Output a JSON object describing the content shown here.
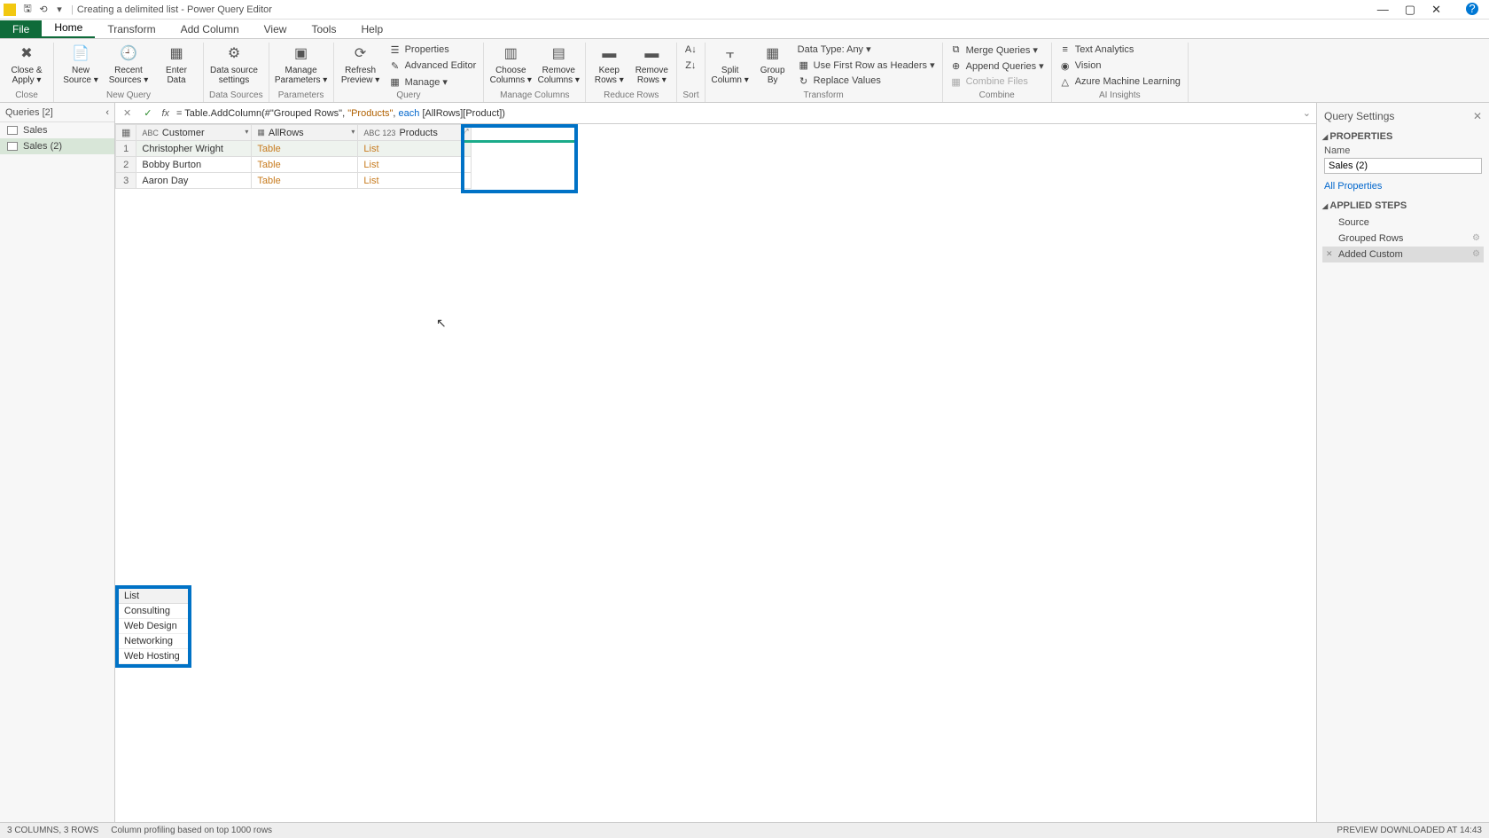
{
  "title": {
    "doc": "Creating a delimited list",
    "app": "Power Query Editor"
  },
  "qat": {
    "save": "🖫",
    "undo": "⟲",
    "redo": "⟳"
  },
  "menu": {
    "file": "File",
    "home": "Home",
    "transform": "Transform",
    "addcol": "Add Column",
    "view": "View",
    "tools": "Tools",
    "help": "Help"
  },
  "ribbon": {
    "close": {
      "label": "Close",
      "btn": "Close &\nApply ▾"
    },
    "newquery": {
      "label": "New Query",
      "new": "New\nSource ▾",
      "recent": "Recent\nSources ▾",
      "enter": "Enter\nData"
    },
    "datasources": {
      "label": "Data Sources",
      "btn": "Data source\nsettings"
    },
    "parameters": {
      "label": "Parameters",
      "btn": "Manage\nParameters ▾"
    },
    "query": {
      "label": "Query",
      "refresh": "Refresh\nPreview ▾",
      "props": "Properties",
      "adv": "Advanced Editor",
      "manage": "Manage ▾"
    },
    "managecols": {
      "label": "Manage Columns",
      "choose": "Choose\nColumns ▾",
      "remove": "Remove\nColumns ▾"
    },
    "reducerows": {
      "label": "Reduce Rows",
      "keep": "Keep\nRows ▾",
      "removerows": "Remove\nRows ▾"
    },
    "sort": {
      "label": "Sort"
    },
    "transform": {
      "label": "Transform",
      "split": "Split\nColumn ▾",
      "group": "Group\nBy",
      "datatype": "Data Type: Any ▾",
      "firstrow": "Use First Row as Headers ▾",
      "replace": "Replace Values"
    },
    "combine": {
      "label": "Combine",
      "merge": "Merge Queries ▾",
      "append": "Append Queries ▾",
      "combinefiles": "Combine Files"
    },
    "ai": {
      "label": "AI Insights",
      "text": "Text Analytics",
      "vision": "Vision",
      "aml": "Azure Machine Learning"
    }
  },
  "queries": {
    "header": "Queries [2]",
    "items": [
      {
        "name": "Sales"
      },
      {
        "name": "Sales (2)"
      }
    ],
    "selected": 1
  },
  "formula": {
    "prefix": "= Table.AddColumn(#\"Grouped Rows\", ",
    "str": "\"Products\"",
    "mid": ", ",
    "kw": "each",
    "suffix": " [AllRows][Product])"
  },
  "grid": {
    "columns": [
      {
        "name": "Customer",
        "type": "ABC"
      },
      {
        "name": "AllRows",
        "type": "▦"
      },
      {
        "name": "Products",
        "type": "ABC\n123"
      }
    ],
    "rows": [
      {
        "n": "1",
        "customer": "Christopher Wright",
        "allrows": "Table",
        "products": "List"
      },
      {
        "n": "2",
        "customer": "Bobby Burton",
        "allrows": "Table",
        "products": "List"
      },
      {
        "n": "3",
        "customer": "Aaron Day",
        "allrows": "Table",
        "products": "List"
      }
    ]
  },
  "preview": {
    "header": "List",
    "items": [
      "Consulting",
      "Web Design",
      "Networking",
      "Web Hosting"
    ]
  },
  "settings": {
    "title": "Query Settings",
    "props": "PROPERTIES",
    "name_lbl": "Name",
    "name_val": "Sales (2)",
    "allprops": "All Properties",
    "steps_lbl": "APPLIED STEPS",
    "steps": [
      {
        "name": "Source"
      },
      {
        "name": "Grouped Rows",
        "gear": true
      },
      {
        "name": "Added Custom",
        "gear": true
      }
    ],
    "selected": 2
  },
  "status": {
    "left": "3 COLUMNS, 3 ROWS",
    "mid": "Column profiling based on top 1000 rows",
    "right": "PREVIEW DOWNLOADED AT 14:43"
  }
}
